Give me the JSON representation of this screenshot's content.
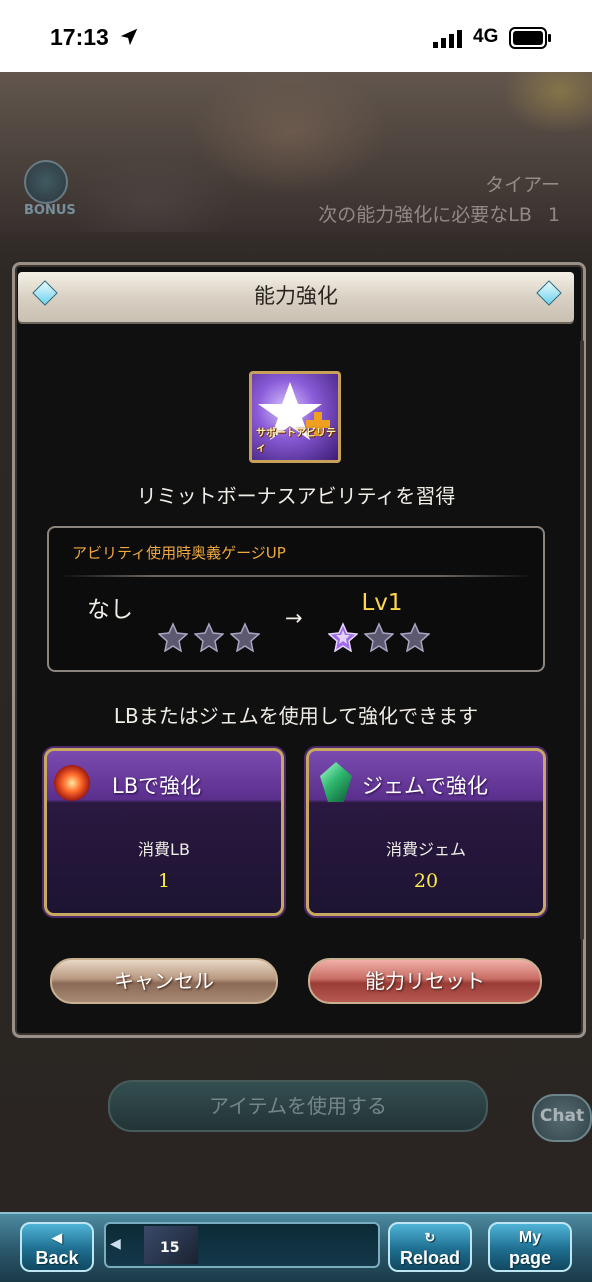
{
  "status_bar": {
    "time": "17:13",
    "network": "4G"
  },
  "background": {
    "bonus_label": "BONUS",
    "character_name": "タイアー",
    "next_lb_label": "次の能力強化に必要なLB",
    "next_lb_value": "1"
  },
  "modal": {
    "title": "能力強化",
    "ability_icon_label": "サポートアビリティ",
    "acquire_text": "リミットボーナスアビリティを習得",
    "ability": {
      "name": "アビリティ使用時奥義ゲージUP",
      "before_level": "なし",
      "after_level": "Lv1",
      "before_stars_filled": 0,
      "after_stars_filled": 1,
      "max_stars": 3
    },
    "instruction": "LBまたはジェムを使用して強化できます",
    "lb_card": {
      "title": "LBで強化",
      "cost_label": "消費LB",
      "cost_value": "1"
    },
    "gem_card": {
      "title": "ジェムで強化",
      "cost_label": "消費ジェム",
      "cost_value": "20"
    },
    "cancel_label": "キャンセル",
    "reset_label": "能力リセット"
  },
  "use_item_label": "アイテムを使用する",
  "chat_label": "Chat",
  "bottom_nav": {
    "back_top": "◀",
    "back_label": "Back",
    "party_level": "15",
    "reload_top": "↻",
    "reload_label": "Reload",
    "mypage_top": "My",
    "mypage_label": "page"
  },
  "colors": {
    "gold_text": "#ffec4a",
    "orange_title": "#f0a840",
    "star_filled": "#a06be8",
    "star_empty": "#5c5870"
  }
}
